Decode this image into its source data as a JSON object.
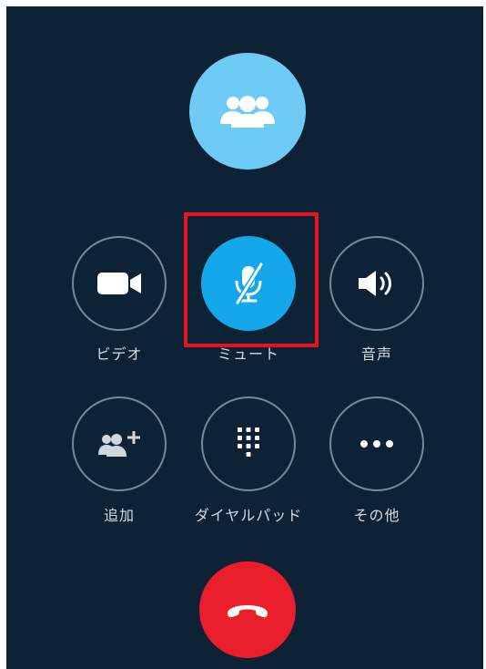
{
  "call": {
    "avatar_icon": "group-people-icon",
    "colors": {
      "background": "#0d2235",
      "avatar": "#6ecbf5",
      "active_button": "#14a8ea",
      "button_border": "#7a8794",
      "end_call": "#ea1f2b",
      "highlight": "#e8141c"
    }
  },
  "controls": {
    "video": {
      "label": "ビデオ",
      "icon": "video-camera-icon"
    },
    "mute": {
      "label": "ミュート",
      "icon": "microphone-muted-icon",
      "active": true
    },
    "speaker": {
      "label": "音声",
      "icon": "speaker-volume-icon"
    },
    "add": {
      "label": "追加",
      "icon": "add-people-icon"
    },
    "dialpad": {
      "label": "ダイヤルパッド",
      "icon": "dialpad-icon"
    },
    "more": {
      "label": "その他",
      "icon": "more-dots-icon"
    }
  },
  "end_call": {
    "icon": "hang-up-phone-icon"
  }
}
